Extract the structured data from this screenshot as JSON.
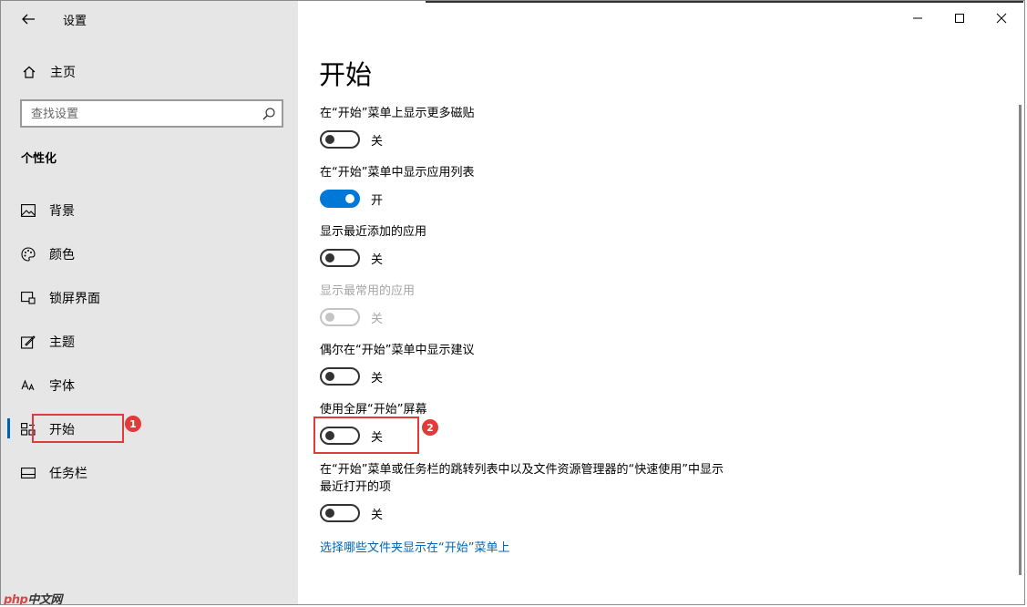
{
  "window": {
    "title": "设置",
    "controls": [
      "minimize",
      "maximize",
      "close"
    ]
  },
  "sidebar": {
    "home_label": "主页",
    "search_placeholder": "查找设置",
    "section_title": "个性化",
    "items": [
      {
        "label": "背景",
        "icon": "picture-icon"
      },
      {
        "label": "颜色",
        "icon": "palette-icon"
      },
      {
        "label": "锁屏界面",
        "icon": "lock-screen-icon"
      },
      {
        "label": "主题",
        "icon": "theme-icon"
      },
      {
        "label": "字体",
        "icon": "font-icon"
      },
      {
        "label": "开始",
        "icon": "start-icon",
        "selected": true
      },
      {
        "label": "任务栏",
        "icon": "taskbar-icon"
      }
    ]
  },
  "content": {
    "page_title": "开始",
    "settings": [
      {
        "label": "在“开始”菜单上显示更多磁贴",
        "state_label": "关",
        "on": false,
        "disabled": false
      },
      {
        "label": "在“开始”菜单中显示应用列表",
        "state_label": "开",
        "on": true,
        "disabled": false
      },
      {
        "label": "显示最近添加的应用",
        "state_label": "关",
        "on": false,
        "disabled": false
      },
      {
        "label": "显示最常用的应用",
        "state_label": "关",
        "on": false,
        "disabled": true
      },
      {
        "label": "偶尔在“开始”菜单中显示建议",
        "state_label": "关",
        "on": false,
        "disabled": false
      },
      {
        "label": "使用全屏“开始”屏幕",
        "state_label": "关",
        "on": false,
        "disabled": false
      },
      {
        "label": "在“开始”菜单或任务栏的跳转列表中以及文件资源管理器的“快速使用”中显示最近打开的项",
        "state_label": "关",
        "on": false,
        "disabled": false
      }
    ],
    "link_text": "选择哪些文件夹显示在“开始”菜单上"
  },
  "annotations": {
    "badge_1": "1",
    "badge_2": "2"
  },
  "watermark": {
    "logo_text": "php",
    "cn_text": "中文网"
  },
  "colors": {
    "accent": "#0078d7",
    "link": "#0066b4",
    "annotation": "#e03b3b",
    "sidebar_bg": "#e6e6e6"
  }
}
